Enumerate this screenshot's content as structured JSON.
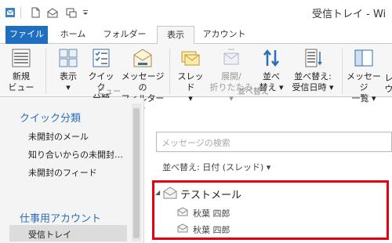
{
  "title_bar": {
    "title": "受信トレイ - Wi"
  },
  "quick_access": [
    "outlook-app-icon",
    "new-item-icon",
    "send-receive-icon",
    "sync-icon",
    "customize-arrow-icon"
  ],
  "tabs": [
    "ファイル",
    "ホーム",
    "フォルダー",
    "表示",
    "アカウント"
  ],
  "active_tab": "表示",
  "ribbon": {
    "new_view": {
      "line1": "新規",
      "line2": "ビュー"
    },
    "view": {
      "line1": "表示",
      "line2": "▾"
    },
    "quick_categories": {
      "line1": "クイック",
      "line2": "分類"
    },
    "message_filter": {
      "line1": "メッセージの",
      "line2": "フィルター ▾"
    },
    "group_view": "ビュー",
    "thread": {
      "line1": "スレッド",
      "line2": "▾"
    },
    "expand_collapse": {
      "line1": "展開/",
      "line2": "折りたたみ ▾"
    },
    "sort": {
      "line1": "並べ",
      "line2": "替え ▾"
    },
    "sort_by_date": {
      "line1": "並べ替え:",
      "line2": "受信日時 ▾"
    },
    "group_sort": "並べ替え",
    "message_list": {
      "line1": "メッセージ",
      "line2": "一覧 ▾"
    },
    "cutoff_right": {
      "line1": "レ",
      "line2": "ウ"
    }
  },
  "left_pane": {
    "quick_categories_heading": "クイック分類",
    "quick_items": [
      "未開封のメール",
      "知り合いからの未開封…",
      "未開封のフィード"
    ],
    "account_heading": "仕事用アカウント",
    "account_items": [
      "受信トレイ"
    ]
  },
  "message_pane": {
    "search_placeholder": "メッセージの検索",
    "sort_label": "並べ替え: 日付 (スレッド)",
    "sort_arrow": "▾",
    "conversation": {
      "expand_glyph": "◢",
      "subject": "テストメール",
      "messages": [
        "秋葉 四郎",
        "秋葉 四郎"
      ]
    }
  },
  "colors": {
    "file_tab": "#1e6ec2",
    "accent_text": "#2a6fb8",
    "highlight": "#e60012"
  }
}
